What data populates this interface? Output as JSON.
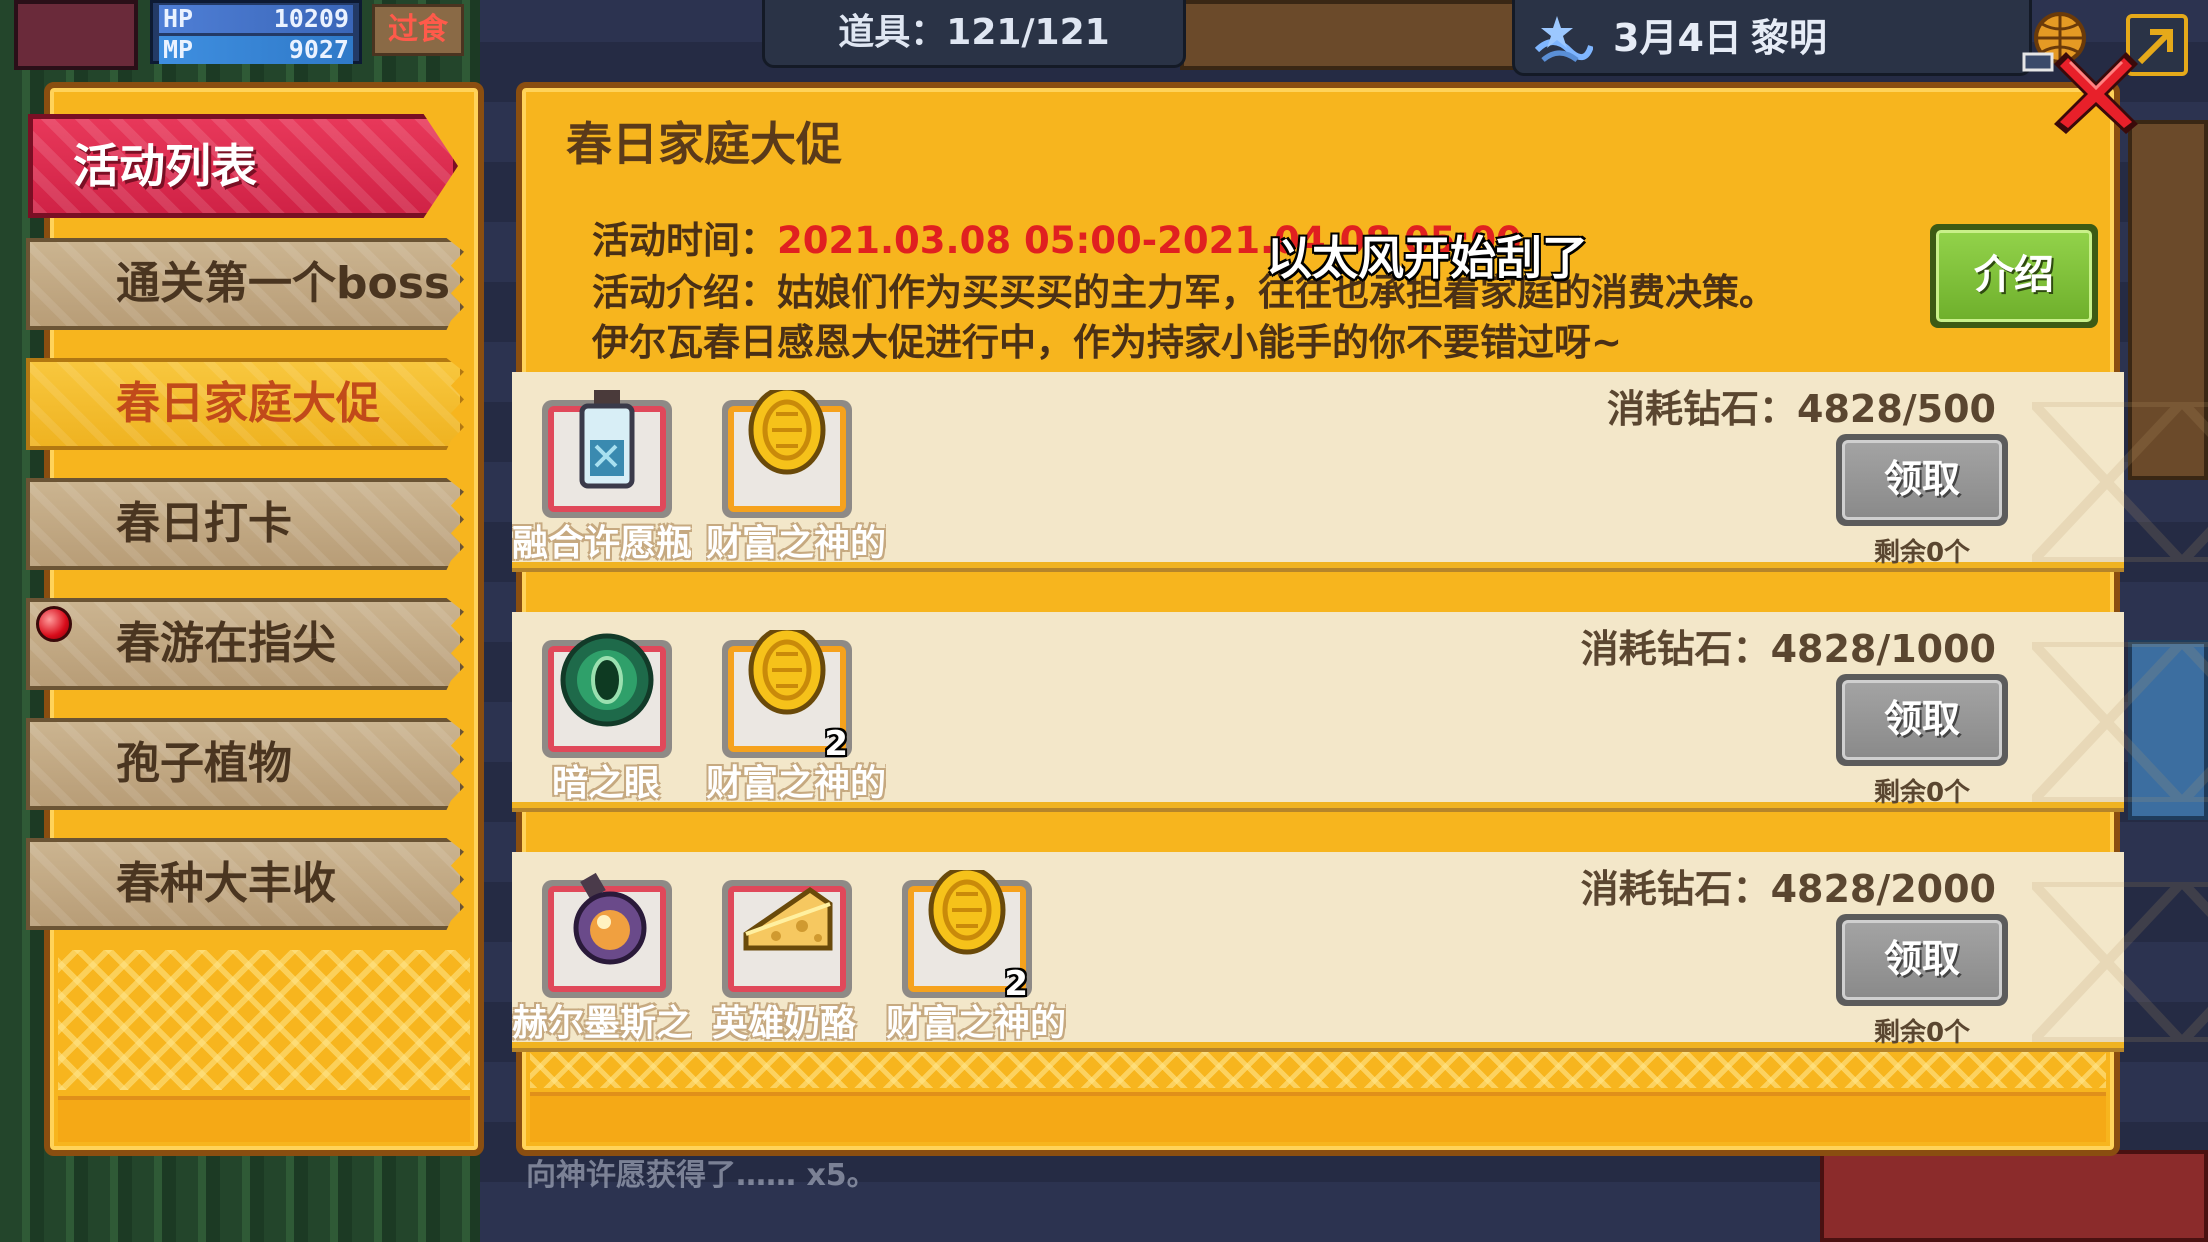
{
  "hud": {
    "hp_label": "HP",
    "hp_value": "10209",
    "mp_label": "MP",
    "mp_value": "9027",
    "hunger_label": "过食",
    "items": "道具：121/121",
    "date": "3月4日",
    "period": "黎明"
  },
  "sidebar": {
    "header": "活动列表",
    "items": [
      {
        "label": "通关第一个boss",
        "active": false
      },
      {
        "label": "春日家庭大促",
        "active": true
      },
      {
        "label": "春日打卡",
        "active": false
      },
      {
        "label": "春游在指尖",
        "active": false,
        "badge": true
      },
      {
        "label": "孢子植物",
        "active": false
      },
      {
        "label": "春种大丰收",
        "active": false
      }
    ]
  },
  "event": {
    "title": "春日家庭大促",
    "time_label": "活动时间：",
    "time_value": "2021.03.08 05:00-2021.04.08 05:00",
    "desc_label": "活动介绍：",
    "desc_line1": "姑娘们作为买买买的主力军，往往也承担着家庭的消费决策。",
    "desc_line2": "伊尔瓦春日感恩大促进行中，作为持家小能手的你不要错过呀~",
    "intro_button": "介绍",
    "subtitle": "以太风开始刮了"
  },
  "rewards": [
    {
      "cost": "消耗钻石：4828/500",
      "claim_label": "领取",
      "remain": "剩余0个",
      "items": [
        {
          "name": "融合许愿瓶",
          "icon": "bottle-icon",
          "qty": ""
        },
        {
          "name": "财富之神的硬币",
          "icon": "gold-coin-icon",
          "qty": ""
        }
      ]
    },
    {
      "cost": "消耗钻石：4828/1000",
      "claim_label": "领取",
      "remain": "剩余0个",
      "items": [
        {
          "name": "暗之眼",
          "icon": "dark-eye-icon",
          "qty": ""
        },
        {
          "name": "财富之神的硬币",
          "icon": "gold-coin-icon",
          "qty": "2"
        }
      ]
    },
    {
      "cost": "消耗钻石：4828/2000",
      "claim_label": "领取",
      "remain": "剩余0个",
      "items": [
        {
          "name": "赫尔墨斯之血",
          "icon": "potion-flask-icon",
          "qty": ""
        },
        {
          "name": "英雄奶酪",
          "icon": "cheese-icon",
          "qty": ""
        },
        {
          "name": "财富之神的硬币",
          "icon": "gold-coin-icon",
          "qty": "2"
        }
      ]
    }
  ],
  "footer_text": "向神许愿获得了…… x5。"
}
